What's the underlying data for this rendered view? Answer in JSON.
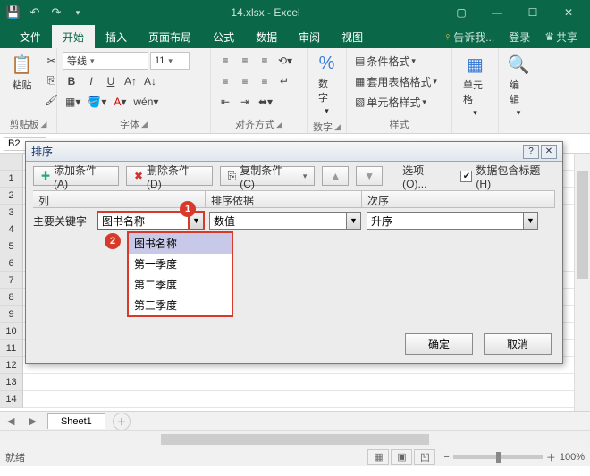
{
  "titlebar": {
    "doc": "14.xlsx - Excel"
  },
  "tabs": {
    "file": "文件",
    "home": "开始",
    "insert": "插入",
    "layout": "页面布局",
    "formulas": "公式",
    "data": "数据",
    "review": "审阅",
    "view": "视图",
    "tell": "告诉我...",
    "signin": "登录",
    "share": "共享"
  },
  "ribbon": {
    "clipboard": {
      "paste": "粘贴",
      "label": "剪贴板"
    },
    "font": {
      "name": "等线",
      "size": "11",
      "label": "字体"
    },
    "align": {
      "label": "对齐方式"
    },
    "number": {
      "btn": "数字",
      "label": "数字"
    },
    "styles": {
      "cond": "条件格式",
      "table": "套用表格格式",
      "cell": "单元格样式",
      "label": "样式"
    },
    "cells": {
      "btn": "单元格"
    },
    "editing": {
      "btn": "编辑"
    }
  },
  "namebox": "B2",
  "sheets": {
    "s1": "Sheet1"
  },
  "status": {
    "ready": "就绪",
    "zoom": "100%"
  },
  "dialog": {
    "title": "排序",
    "addcond": "添加条件(A)",
    "delcond": "删除条件(D)",
    "copycond": "复制条件(C)",
    "options": "选项(O)...",
    "header_chk": "数据包含标题(H)",
    "col_header": "列",
    "sorton_header": "排序依据",
    "order_header": "次序",
    "primary_label": "主要关键字",
    "primary_value": "图书名称",
    "sorton_value": "数值",
    "order_value": "升序",
    "ok": "确定",
    "cancel": "取消",
    "options_list": {
      "o0": "图书名称",
      "o1": "第一季度",
      "o2": "第二季度",
      "o3": "第三季度"
    },
    "badge1": "1",
    "badge2": "2"
  }
}
